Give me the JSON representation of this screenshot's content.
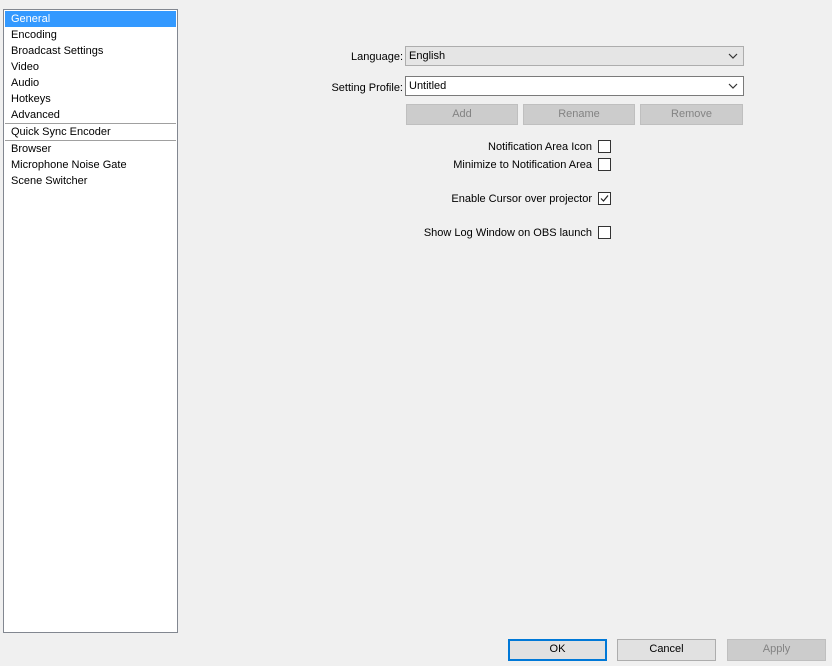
{
  "sidebar": {
    "items": [
      {
        "label": "General",
        "selected": true
      },
      {
        "label": "Encoding"
      },
      {
        "label": "Broadcast Settings"
      },
      {
        "label": "Video"
      },
      {
        "label": "Audio"
      },
      {
        "label": "Hotkeys"
      },
      {
        "label": "Advanced"
      },
      {
        "label": "Quick Sync Encoder"
      },
      {
        "label": "Browser"
      },
      {
        "label": "Microphone Noise Gate"
      },
      {
        "label": "Scene Switcher"
      }
    ]
  },
  "general": {
    "language_label": "Language:",
    "language_value": "English",
    "profile_label": "Setting Profile:",
    "profile_value": "Untitled",
    "add_label": "Add",
    "rename_label": "Rename",
    "remove_label": "Remove",
    "notification_icon_label": "Notification Area Icon",
    "notification_icon_checked": false,
    "minimize_label": "Minimize to Notification Area",
    "minimize_checked": false,
    "cursor_label": "Enable Cursor over projector",
    "cursor_checked": true,
    "log_label": "Show Log Window on OBS launch",
    "log_checked": false
  },
  "footer": {
    "ok_label": "OK",
    "cancel_label": "Cancel",
    "apply_label": "Apply"
  },
  "colors": {
    "selection": "#3399ff",
    "default_button_border": "#0078d7"
  }
}
